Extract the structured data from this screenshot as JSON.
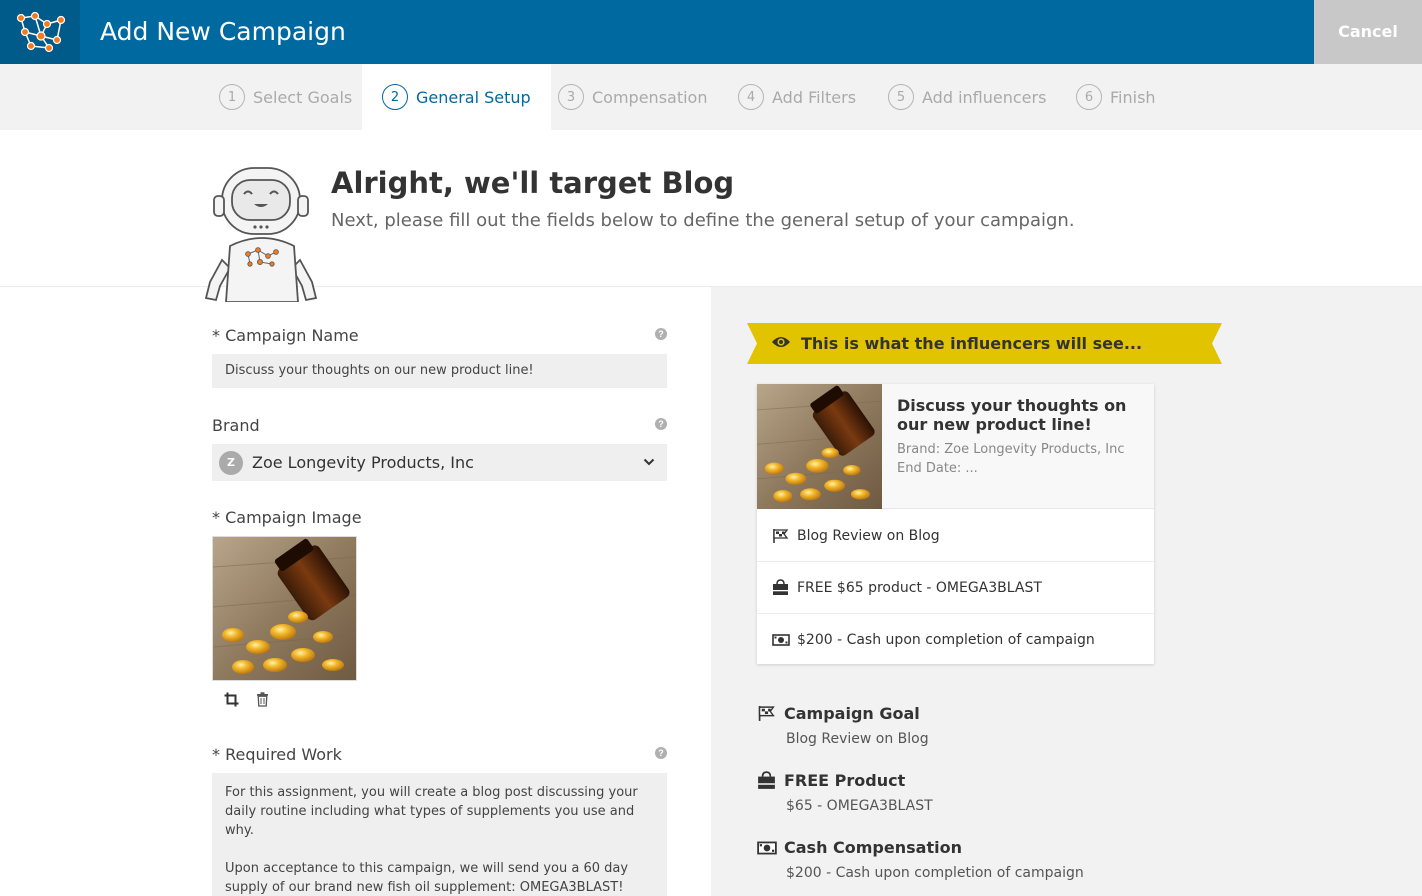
{
  "header": {
    "title": "Add New Campaign",
    "cancel_label": "Cancel"
  },
  "steps": [
    {
      "num": "1",
      "label": "Select Goals",
      "active": false
    },
    {
      "num": "2",
      "label": "General Setup",
      "active": true
    },
    {
      "num": "3",
      "label": "Compensation",
      "active": false
    },
    {
      "num": "4",
      "label": "Add Filters",
      "active": false
    },
    {
      "num": "5",
      "label": "Add influencers",
      "active": false
    },
    {
      "num": "6",
      "label": "Finish",
      "active": false
    }
  ],
  "intro": {
    "title": "Alright, we'll target Blog",
    "subtitle": "Next, please fill out the fields below to define the general setup of your campaign."
  },
  "form": {
    "campaign_name": {
      "label": "* Campaign Name",
      "value": "Discuss your thoughts on our new product line!"
    },
    "brand": {
      "label": "Brand",
      "avatar_letter": "Z",
      "value": "Zoe Longevity Products, Inc"
    },
    "campaign_image": {
      "label": "* Campaign Image"
    },
    "required_work": {
      "label": "* Required Work",
      "paragraphs": [
        "For this assignment, you will create a blog post discussing your daily routine including what types of supplements you use and why.",
        "Upon acceptance to this campaign, we will send you a 60 day supply of our brand new fish oil supplement: OMEGA3BLAST!"
      ]
    },
    "help_glyph": "?"
  },
  "preview": {
    "banner": "This is what the influencers will see...",
    "card": {
      "title": "Discuss your thoughts on our new product line!",
      "brand_line": "Brand: Zoe Longevity Products, Inc",
      "end_date_line": "End Date: ...",
      "rows": [
        {
          "icon": "flag-icon",
          "text": "Blog Review on Blog"
        },
        {
          "icon": "shopping-bag-icon",
          "text": "FREE $65 product - OMEGA3BLAST"
        },
        {
          "icon": "money-icon",
          "text": "$200 - Cash upon completion of campaign"
        }
      ]
    }
  },
  "summary": [
    {
      "icon": "flag-icon",
      "title": "Campaign Goal",
      "value": "Blog Review on Blog"
    },
    {
      "icon": "shopping-bag-icon",
      "title": "FREE Product",
      "value": "$65 - OMEGA3BLAST"
    },
    {
      "icon": "money-icon",
      "title": "Cash Compensation",
      "value": "$200 - Cash upon completion of campaign"
    }
  ],
  "colors": {
    "header_blue": "#00699f",
    "banner_yellow": "#e2c300",
    "panel_gray": "#f2f2f2"
  }
}
